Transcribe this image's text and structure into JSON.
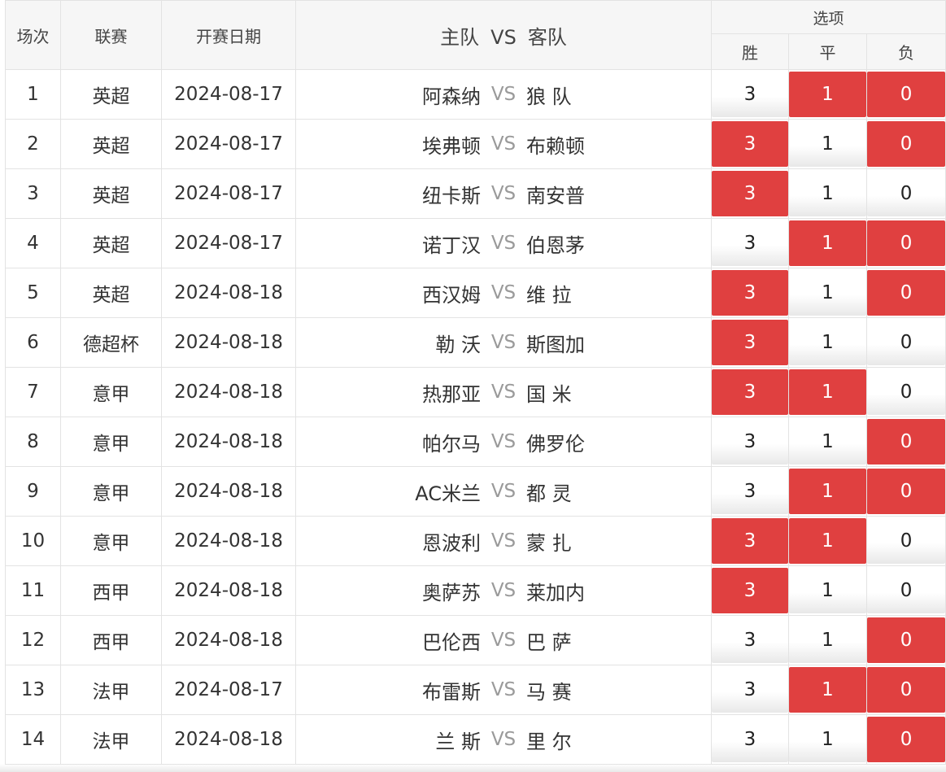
{
  "colors": {
    "selected": "#e04040",
    "selected_text": "#ffffff",
    "header_bg": "#f6f6f6",
    "border": "#e3e3e3",
    "vs_text": "#9a9a9a"
  },
  "header": {
    "no": "场次",
    "league": "联赛",
    "date": "开赛日期",
    "home": "主队",
    "vs": "VS",
    "away": "客队",
    "options": "选项",
    "win": "胜",
    "draw": "平",
    "lose": "负"
  },
  "rows": [
    {
      "no": "1",
      "league": "英超",
      "date": "2024-08-17",
      "home": "阿森纳",
      "vs": "VS",
      "away": "狼 队",
      "win": "3",
      "draw": "1",
      "lose": "0",
      "win_selected": false,
      "draw_selected": true,
      "lose_selected": true
    },
    {
      "no": "2",
      "league": "英超",
      "date": "2024-08-17",
      "home": "埃弗顿",
      "vs": "VS",
      "away": "布赖顿",
      "win": "3",
      "draw": "1",
      "lose": "0",
      "win_selected": true,
      "draw_selected": false,
      "lose_selected": true
    },
    {
      "no": "3",
      "league": "英超",
      "date": "2024-08-17",
      "home": "纽卡斯",
      "vs": "VS",
      "away": "南安普",
      "win": "3",
      "draw": "1",
      "lose": "0",
      "win_selected": true,
      "draw_selected": false,
      "lose_selected": false
    },
    {
      "no": "4",
      "league": "英超",
      "date": "2024-08-17",
      "home": "诺丁汉",
      "vs": "VS",
      "away": "伯恩茅",
      "win": "3",
      "draw": "1",
      "lose": "0",
      "win_selected": false,
      "draw_selected": true,
      "lose_selected": true
    },
    {
      "no": "5",
      "league": "英超",
      "date": "2024-08-18",
      "home": "西汉姆",
      "vs": "VS",
      "away": "维 拉",
      "win": "3",
      "draw": "1",
      "lose": "0",
      "win_selected": true,
      "draw_selected": false,
      "lose_selected": true
    },
    {
      "no": "6",
      "league": "德超杯",
      "date": "2024-08-18",
      "home": "勒 沃",
      "vs": "VS",
      "away": "斯图加",
      "win": "3",
      "draw": "1",
      "lose": "0",
      "win_selected": true,
      "draw_selected": false,
      "lose_selected": false
    },
    {
      "no": "7",
      "league": "意甲",
      "date": "2024-08-18",
      "home": "热那亚",
      "vs": "VS",
      "away": "国 米",
      "win": "3",
      "draw": "1",
      "lose": "0",
      "win_selected": true,
      "draw_selected": true,
      "lose_selected": false
    },
    {
      "no": "8",
      "league": "意甲",
      "date": "2024-08-18",
      "home": "帕尔马",
      "vs": "VS",
      "away": "佛罗伦",
      "win": "3",
      "draw": "1",
      "lose": "0",
      "win_selected": false,
      "draw_selected": false,
      "lose_selected": true
    },
    {
      "no": "9",
      "league": "意甲",
      "date": "2024-08-18",
      "home": "AC米兰",
      "vs": "VS",
      "away": "都 灵",
      "win": "3",
      "draw": "1",
      "lose": "0",
      "win_selected": false,
      "draw_selected": true,
      "lose_selected": true
    },
    {
      "no": "10",
      "league": "意甲",
      "date": "2024-08-18",
      "home": "恩波利",
      "vs": "VS",
      "away": "蒙 扎",
      "win": "3",
      "draw": "1",
      "lose": "0",
      "win_selected": true,
      "draw_selected": true,
      "lose_selected": false
    },
    {
      "no": "11",
      "league": "西甲",
      "date": "2024-08-18",
      "home": "奥萨苏",
      "vs": "VS",
      "away": "莱加内",
      "win": "3",
      "draw": "1",
      "lose": "0",
      "win_selected": true,
      "draw_selected": false,
      "lose_selected": false
    },
    {
      "no": "12",
      "league": "西甲",
      "date": "2024-08-18",
      "home": "巴伦西",
      "vs": "VS",
      "away": "巴 萨",
      "win": "3",
      "draw": "1",
      "lose": "0",
      "win_selected": false,
      "draw_selected": false,
      "lose_selected": true
    },
    {
      "no": "13",
      "league": "法甲",
      "date": "2024-08-17",
      "home": "布雷斯",
      "vs": "VS",
      "away": "马 赛",
      "win": "3",
      "draw": "1",
      "lose": "0",
      "win_selected": false,
      "draw_selected": true,
      "lose_selected": true
    },
    {
      "no": "14",
      "league": "法甲",
      "date": "2024-08-18",
      "home": "兰 斯",
      "vs": "VS",
      "away": "里 尔",
      "win": "3",
      "draw": "1",
      "lose": "0",
      "win_selected": false,
      "draw_selected": false,
      "lose_selected": true
    }
  ]
}
